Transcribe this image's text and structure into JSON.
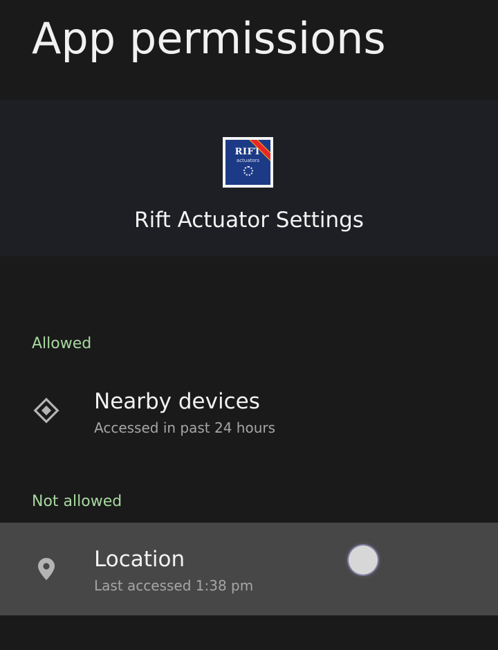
{
  "header": {
    "title": "App permissions"
  },
  "app": {
    "name": "Rift Actuator Settings",
    "icon_name": "rift-actuators-app-icon",
    "icon_brand_text": "RIFT",
    "icon_sub_text": "actuators"
  },
  "sections": {
    "allowed": {
      "label": "Allowed",
      "items": [
        {
          "title": "Nearby devices",
          "subtitle": "Accessed in past 24 hours",
          "icon": "nearby-devices-icon"
        }
      ]
    },
    "not_allowed": {
      "label": "Not allowed",
      "items": [
        {
          "title": "Location",
          "subtitle": "Last accessed 1:38 pm",
          "icon": "location-pin-icon"
        }
      ]
    }
  },
  "colors": {
    "background": "#1a1a1a",
    "header_band": "#1e1f24",
    "section_label": "#a8d8a0",
    "highlight_row": "#474747"
  }
}
